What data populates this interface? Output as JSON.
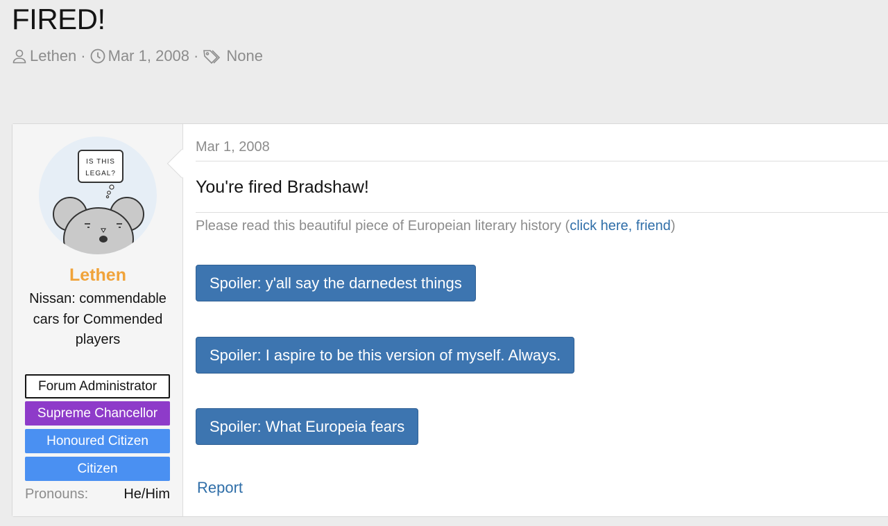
{
  "thread": {
    "title": "FIRED!",
    "author": "Lethen",
    "date": "Mar 1, 2008",
    "tags": "None",
    "separator": "·"
  },
  "user": {
    "name": "Lethen",
    "title": "Nissan: commendable cars for Commended players",
    "avatar_text_line1": "IS THIS",
    "avatar_text_line2": "LEGAL?",
    "banners": {
      "admin": "Forum Administrator",
      "supreme": "Supreme Chancellor",
      "honoured": "Honoured Citizen",
      "citizen": "Citizen"
    },
    "pronouns_label": "Pronouns:",
    "pronouns_value": "He/Him"
  },
  "post": {
    "date": "Mar 1, 2008",
    "heading": "You're fired Bradshaw!",
    "body_prefix": "Please read this beautiful piece of Europeian literary history (",
    "body_link": "click here, friend",
    "body_suffix": ")",
    "spoilers": [
      "Spoiler: y'all say the darnedest things",
      "Spoiler: I aspire to be this version of myself. Always.",
      "Spoiler: What Europeia fears"
    ],
    "report_label": "Report"
  },
  "colors": {
    "username": "#f0a33a",
    "supreme_banner": "#8e3bc9",
    "citizen_banner": "#4a90f2",
    "spoiler_button": "#3d75b0",
    "link": "#2f6ea8"
  }
}
